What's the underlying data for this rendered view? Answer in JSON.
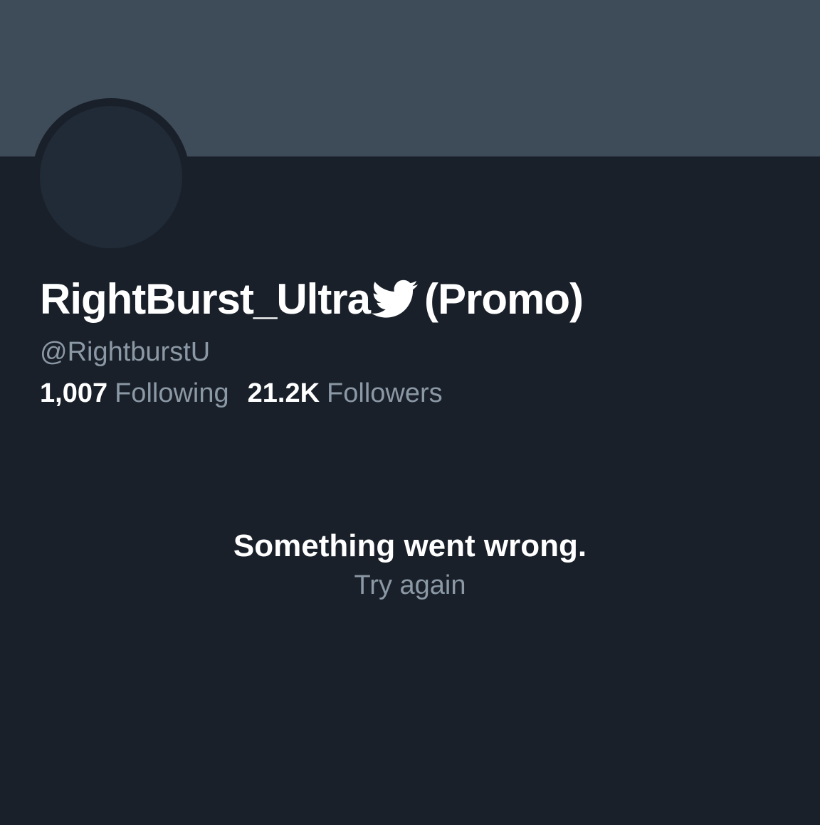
{
  "profile": {
    "display_name": "RightBurst_Ultra",
    "name_suffix": "(Promo)",
    "name_icon": "twitter-bird-icon",
    "handle": "@RightburstU",
    "following_count": "1,007",
    "following_label": "Following",
    "followers_count": "21.2K",
    "followers_label": "Followers"
  },
  "error": {
    "message": "Something went wrong.",
    "retry_label": "Try again"
  },
  "colors": {
    "background": "#19202a",
    "banner": "#3e4b59",
    "avatar": "#212b38",
    "primary_text": "#ffffff",
    "secondary_text": "#8b98a5"
  }
}
